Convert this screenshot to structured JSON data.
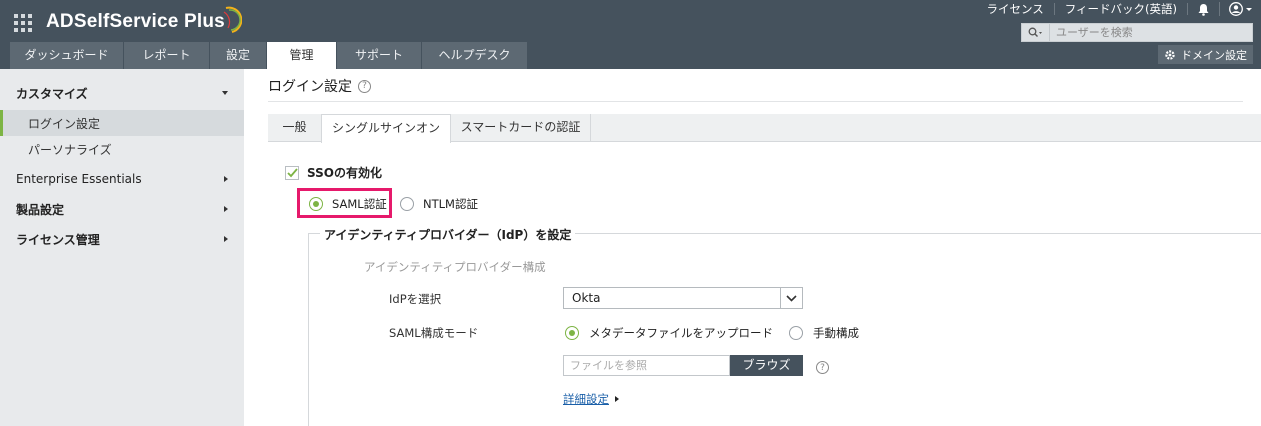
{
  "header": {
    "app_title": "ADSelfService Plus",
    "links": [
      "ライセンス",
      "フィードバック(英語)"
    ],
    "search_placeholder": "ユーザーを検索",
    "domain_button": "ドメイン設定",
    "colors": {
      "header_bg": "#45525d",
      "accent": "#7db444",
      "highlight": "#e6196b"
    }
  },
  "tabs": [
    {
      "label": "ダッシュボード",
      "active": false
    },
    {
      "label": "レポート",
      "active": false
    },
    {
      "label": "設定",
      "active": false
    },
    {
      "label": "管理",
      "active": true
    },
    {
      "label": "サポート",
      "active": false
    },
    {
      "label": "ヘルプデスク",
      "active": false
    }
  ],
  "sidebar": {
    "items": [
      {
        "label": "カスタマイズ",
        "expanded": true
      },
      {
        "label": "ログイン設定",
        "selected": true
      },
      {
        "label": "パーソナライズ"
      },
      {
        "label": "Enterprise Essentials"
      },
      {
        "label": "製品設定"
      },
      {
        "label": "ライセンス管理"
      }
    ]
  },
  "main": {
    "page_title": "ログイン設定",
    "subtabs": [
      {
        "label": "一般"
      },
      {
        "label": "シングルサインオン",
        "active": true
      },
      {
        "label": "スマートカードの認証"
      }
    ],
    "sso_enable_label": "SSOの有効化",
    "auth_options": [
      {
        "label": "SAML認証",
        "selected": true
      },
      {
        "label": "NTLM認証",
        "selected": false
      }
    ],
    "idp_section": {
      "legend": "アイデンティティプロバイダー（IdP）を設定",
      "subheading": "アイデンティティプロバイダー構成",
      "idp_label": "IdPを選択",
      "idp_value": "Okta",
      "mode_label": "SAML構成モード",
      "mode_options": [
        {
          "label": "メタデータファイルをアップロード",
          "selected": true
        },
        {
          "label": "手動構成",
          "selected": false
        }
      ],
      "file_placeholder": "ファイルを参照",
      "browse_label": "ブラウズ",
      "advanced_link": "詳細設定"
    }
  }
}
